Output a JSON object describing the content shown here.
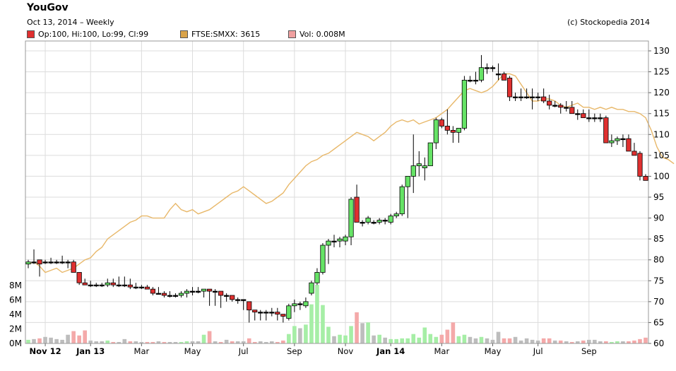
{
  "header": {
    "title": "YouGov",
    "subtitle": "Oct 13, 2014  –  Weekly",
    "credit": "(c) Stockopedia 2014"
  },
  "legend": [
    {
      "label": "Op:100, Hi:100, Lo:99, Cl:99",
      "color": "#e03030"
    },
    {
      "label": "FTSE:SMXX: 3615",
      "color": "#d9a34a"
    },
    {
      "label": "Vol: 0.008M",
      "color": "#f0a0a0"
    }
  ],
  "colors": {
    "up": "#66e366",
    "down": "#e03030",
    "ftse": "#e8b86a",
    "grid": "#dcdcdc",
    "vol_up": "#a6eea6",
    "vol_down": "#f4a9a9",
    "vol_neutral": "#bdbdbd"
  },
  "chart_data": {
    "type": "candlestick",
    "price_axis": {
      "range": [
        60,
        130
      ],
      "ticks": [
        "60",
        "65",
        "70",
        "75",
        "80",
        "85",
        "90",
        "95",
        "100",
        "105",
        "110",
        "115",
        "120",
        "125",
        "130"
      ]
    },
    "volume_axis": {
      "unit": "M",
      "range": [
        0,
        8
      ],
      "ticks": [
        "0M",
        "2M",
        "4M",
        "6M",
        "8M"
      ]
    },
    "x_ticks": [
      {
        "label": "Nov 12",
        "week": 3,
        "bold": true
      },
      {
        "label": "Jan 13",
        "week": 11,
        "bold": true
      },
      {
        "label": "Mar",
        "week": 20,
        "bold": false
      },
      {
        "label": "May",
        "week": 29,
        "bold": false
      },
      {
        "label": "Jul",
        "week": 38,
        "bold": false
      },
      {
        "label": "Sep",
        "week": 47,
        "bold": false
      },
      {
        "label": "Nov",
        "week": 56,
        "bold": false
      },
      {
        "label": "Jan 14",
        "week": 64,
        "bold": true
      },
      {
        "label": "Mar",
        "week": 73,
        "bold": false
      },
      {
        "label": "May",
        "week": 82,
        "bold": false
      },
      {
        "label": "Jul",
        "week": 90,
        "bold": false
      },
      {
        "label": "Sep",
        "week": 99,
        "bold": false
      }
    ],
    "candles": [
      [
        79,
        80,
        78,
        79.5
      ],
      [
        79.5,
        82.5,
        79,
        79.5
      ],
      [
        80,
        80,
        76,
        79
      ],
      [
        79.5,
        80,
        79,
        79.5
      ],
      [
        79.5,
        80.5,
        79,
        79.5
      ],
      [
        79.5,
        80,
        79,
        79.5
      ],
      [
        79.5,
        81,
        79,
        79.5
      ],
      [
        79.5,
        80,
        78,
        79.5
      ],
      [
        79.5,
        80,
        77,
        77
      ],
      [
        77,
        77,
        74,
        74.5
      ],
      [
        74.5,
        75.5,
        74,
        74
      ],
      [
        74,
        75,
        73.5,
        74
      ],
      [
        74,
        74.5,
        73.5,
        74
      ],
      [
        74,
        74.5,
        73.5,
        74
      ],
      [
        74,
        75.5,
        73.5,
        74.5
      ],
      [
        74.5,
        75.5,
        73.5,
        74
      ],
      [
        74,
        76,
        73.5,
        74
      ],
      [
        74,
        76,
        73.5,
        74
      ],
      [
        74,
        75.5,
        73,
        73.5
      ],
      [
        73.5,
        74.5,
        73,
        73.5
      ],
      [
        73.5,
        74,
        73,
        73.5
      ],
      [
        73.5,
        74,
        73,
        73
      ],
      [
        73,
        73.5,
        71.5,
        72
      ],
      [
        72,
        73.5,
        72,
        72
      ],
      [
        72,
        72.5,
        71,
        71.5
      ],
      [
        71.5,
        72.5,
        71,
        71.5
      ],
      [
        71.5,
        72,
        71,
        71.5
      ],
      [
        71.5,
        72.5,
        71,
        72
      ],
      [
        72,
        73,
        71,
        72.5
      ],
      [
        72.5,
        73.5,
        71.5,
        72.5
      ],
      [
        72.5,
        73.5,
        72,
        72.5
      ],
      [
        72.5,
        73,
        71,
        73
      ],
      [
        73,
        73,
        69,
        72.5
      ],
      [
        72.5,
        73,
        69,
        72.5
      ],
      [
        72.5,
        72.5,
        68.5,
        71.5
      ],
      [
        71.5,
        72,
        70,
        71.5
      ],
      [
        71.5,
        71.5,
        70,
        70.5
      ],
      [
        70.5,
        71,
        69.5,
        70.5
      ],
      [
        70.5,
        70.5,
        68,
        70.5
      ],
      [
        70,
        70,
        65,
        68
      ],
      [
        68,
        68,
        65.5,
        67.5
      ],
      [
        67.5,
        68,
        65.5,
        67.5
      ],
      [
        67.5,
        68,
        65.5,
        67.5
      ],
      [
        67.5,
        68.5,
        66.5,
        67.5
      ],
      [
        67.5,
        68.5,
        65.5,
        67
      ],
      [
        67,
        67,
        65,
        66.5
      ],
      [
        66,
        69.5,
        65.5,
        69
      ],
      [
        69,
        70.5,
        67.5,
        69.5
      ],
      [
        69.5,
        70,
        68,
        69.5
      ],
      [
        69,
        71,
        68.5,
        70
      ],
      [
        72,
        75,
        71.5,
        74.5
      ],
      [
        74.5,
        78,
        74,
        77
      ],
      [
        77,
        84,
        76.5,
        83.5
      ],
      [
        83.5,
        85,
        79,
        84.5
      ],
      [
        84.5,
        86,
        83,
        84.5
      ],
      [
        84.5,
        85.5,
        83,
        85
      ],
      [
        84.5,
        86,
        83.5,
        85.5
      ],
      [
        85.5,
        95,
        83.5,
        94.5
      ],
      [
        95,
        98,
        89,
        89
      ],
      [
        89,
        89.5,
        88,
        89
      ],
      [
        89,
        90.5,
        88.5,
        90
      ],
      [
        89,
        89.5,
        88.5,
        89
      ],
      [
        89,
        90,
        88.5,
        89.5
      ],
      [
        89.5,
        90,
        88.5,
        89.5
      ],
      [
        89,
        91,
        88.5,
        90.5
      ],
      [
        90.5,
        91.5,
        90,
        91
      ],
      [
        91,
        98,
        90.5,
        97.5
      ],
      [
        97.5,
        100,
        90,
        100
      ],
      [
        100,
        110,
        96,
        102.5
      ],
      [
        102.5,
        106,
        100,
        103
      ],
      [
        102,
        104.5,
        99,
        102.5
      ],
      [
        102.5,
        108,
        102.5,
        108
      ],
      [
        108,
        114,
        106.5,
        113.5
      ],
      [
        113.5,
        114,
        111.5,
        112
      ],
      [
        112,
        116,
        110,
        111
      ],
      [
        111,
        112,
        108,
        110.5
      ],
      [
        110.5,
        111.5,
        108,
        111.5
      ],
      [
        111.5,
        124,
        111,
        123
      ],
      [
        123,
        124,
        122.5,
        123
      ],
      [
        123,
        125,
        122,
        123
      ],
      [
        123,
        129,
        122.5,
        126
      ],
      [
        126,
        127,
        124.5,
        126
      ],
      [
        126,
        126.5,
        125,
        126
      ],
      [
        124.5,
        127,
        123,
        124.5
      ],
      [
        124.5,
        125,
        124,
        123
      ],
      [
        123.5,
        124,
        118,
        119
      ],
      [
        119,
        120,
        118,
        119
      ],
      [
        119,
        121,
        118,
        119
      ],
      [
        119,
        121,
        118.5,
        119
      ],
      [
        119,
        121,
        116,
        119
      ],
      [
        119,
        120,
        118,
        119
      ],
      [
        119,
        121,
        117.5,
        118
      ],
      [
        118,
        119.5,
        116,
        117
      ],
      [
        117,
        118,
        116.5,
        117
      ],
      [
        117,
        117.5,
        115,
        116.5
      ],
      [
        116.5,
        118,
        115.5,
        116.5
      ],
      [
        116.5,
        118,
        115.5,
        115
      ],
      [
        115,
        116,
        113.5,
        115
      ],
      [
        115,
        116,
        114,
        114
      ],
      [
        114,
        116,
        113,
        114
      ],
      [
        114,
        115,
        113,
        114
      ],
      [
        114,
        115,
        113,
        114
      ],
      [
        114,
        114.5,
        108,
        108
      ],
      [
        108,
        110,
        107,
        108.5
      ],
      [
        108.5,
        109.5,
        107.5,
        109
      ],
      [
        109,
        110,
        107,
        109
      ],
      [
        109,
        110,
        107.5,
        106
      ],
      [
        106,
        108,
        105,
        105
      ],
      [
        105.5,
        106,
        99,
        100
      ],
      [
        100,
        100.5,
        99,
        99
      ]
    ],
    "volume": [
      0.5,
      0.6,
      0.7,
      0.9,
      0.8,
      0.6,
      0.5,
      1.2,
      1.7,
      1.1,
      1.8,
      0.4,
      0.3,
      0.3,
      0.4,
      0.2,
      0.2,
      0.6,
      0.3,
      0.3,
      0.2,
      0.2,
      0.2,
      0.3,
      0.2,
      0.2,
      0.2,
      0.2,
      0.3,
      0.3,
      0.3,
      1.2,
      1.7,
      0.3,
      0.2,
      0.5,
      0.3,
      0.3,
      0.3,
      0.7,
      0.2,
      0.3,
      0.2,
      0.3,
      0.2,
      0.4,
      1.3,
      2.4,
      2.1,
      2.6,
      5.4,
      8.1,
      5.3,
      2.3,
      1.0,
      1.2,
      1.1,
      2.4,
      4.3,
      2.8,
      2.9,
      1.1,
      1.2,
      0.8,
      0.6,
      0.6,
      0.7,
      0.7,
      1.3,
      0.8,
      2.2,
      1.3,
      0.9,
      1.2,
      1.9,
      2.9,
      1.0,
      1.2,
      0.9,
      0.7,
      0.9,
      0.7,
      0.5,
      1.6,
      0.7,
      0.7,
      0.9,
      0.4,
      0.7,
      0.5,
      0.4,
      0.7,
      0.7,
      0.4,
      0.4,
      0.3,
      0.2,
      0.3,
      0.4,
      0.5,
      0.5,
      0.3,
      0.3,
      0.2,
      0.3,
      0.3,
      0.3,
      0.4,
      0.6,
      0.8
    ],
    "ftse": [
      79,
      79.5,
      78.5,
      77,
      77.5,
      78,
      77,
      77.5,
      78,
      79,
      80,
      80.5,
      82,
      83,
      85,
      86,
      87,
      88,
      89,
      89.5,
      90.5,
      90.5,
      90,
      90,
      90,
      92,
      93.5,
      92,
      91.5,
      92,
      91,
      91.5,
      92,
      93,
      94,
      95,
      96,
      96.5,
      97.5,
      96.5,
      95.5,
      94.5,
      93.5,
      94,
      95,
      96,
      98,
      99.5,
      101,
      102.5,
      103.5,
      104,
      105,
      105.5,
      106.5,
      107.5,
      108.5,
      109.5,
      110.5,
      110,
      109.5,
      108.5,
      109.5,
      110.5,
      112,
      113,
      113.5,
      113,
      113.5,
      112.5,
      113,
      113.5,
      114,
      115,
      116,
      117.5,
      119,
      120.5,
      121,
      120.5,
      120,
      120.5,
      121.5,
      123,
      124.5,
      124.5,
      124,
      122,
      120,
      118,
      118,
      118.5,
      118.5,
      118,
      117,
      116.5,
      117,
      117.5,
      116.5,
      116.5,
      116,
      116.5,
      116,
      116.5,
      116,
      116,
      115.5,
      115.5,
      115,
      114,
      111,
      107,
      104.5,
      104,
      103
    ]
  }
}
